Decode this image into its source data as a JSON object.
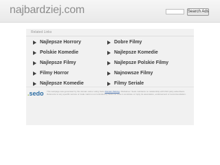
{
  "header": {
    "domain": "najbardziej.com",
    "search_placeholder": "",
    "search_button_label": "Search Ads"
  },
  "related": {
    "title": "Related Links",
    "links": [
      "Najlepsze Horrory",
      "Dobre Filmy",
      "Polskie Komedie",
      "Najlepsze Komedie",
      "Najlepsze Filmy",
      "Najlepsze Polskie Filmy",
      "Filmy Horror",
      "Najnowsze Filmy",
      "Najlepsze Komedie",
      "Filmy Seriale"
    ]
  },
  "footer": {
    "logo_text": "sedo",
    "disclaimer_before_link": "This webpage was generated by the domain owner using Sedo",
    "disclaimer_link": "Domain Parking",
    "disclaimer_after_link": ". Disclaimer: Sedo maintains no relationship with third party advertisers. Reference to any specific service or trade mark is not controlled by Sedo nor does it constitute or imply its association, endorsement or recommendation."
  },
  "colors": {
    "header_background": "#eeeeee",
    "links_box_background": "#f1f1f1",
    "link_text": "#3a3a3a",
    "sedo_blue": "#2b6ca3",
    "sedo_green": "#8db33c"
  }
}
